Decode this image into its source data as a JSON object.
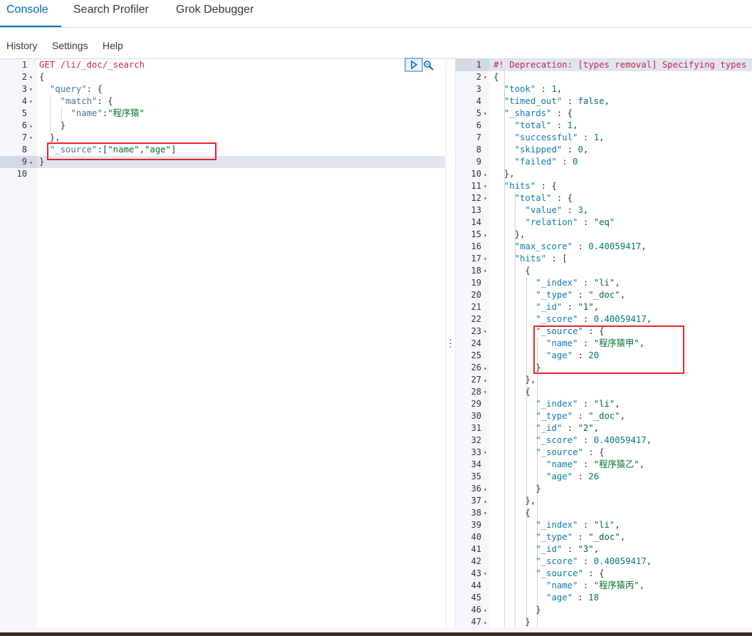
{
  "tabs": [
    "Console",
    "Search Profiler",
    "Grok Debugger"
  ],
  "menu": [
    "History",
    "Settings",
    "Help"
  ],
  "request": {
    "lines": [
      [
        {
          "t": "m",
          "v": "GET /li/_doc/_search"
        }
      ],
      [
        {
          "t": "p",
          "v": "{"
        }
      ],
      [
        {
          "t": "p",
          "v": "  "
        },
        {
          "t": "k",
          "v": "\"query\""
        },
        {
          "t": "p",
          "v": ": {"
        }
      ],
      [
        {
          "t": "p",
          "v": "    "
        },
        {
          "t": "k",
          "v": "\"match\""
        },
        {
          "t": "p",
          "v": ": {"
        }
      ],
      [
        {
          "t": "p",
          "v": "      "
        },
        {
          "t": "k",
          "v": "\"name\""
        },
        {
          "t": "p",
          "v": ":"
        },
        {
          "t": "s",
          "v": "\"程序猿\""
        }
      ],
      [
        {
          "t": "p",
          "v": "    }"
        }
      ],
      [
        {
          "t": "p",
          "v": "  },"
        }
      ],
      [
        {
          "t": "p",
          "v": "  "
        },
        {
          "t": "k",
          "v": "\"_source\""
        },
        {
          "t": "p",
          "v": ":["
        },
        {
          "t": "s",
          "v": "\"name\""
        },
        {
          "t": "p",
          "v": ","
        },
        {
          "t": "s",
          "v": "\"age\""
        },
        {
          "t": "p",
          "v": "]"
        }
      ],
      [
        {
          "t": "p",
          "v": "}"
        }
      ],
      []
    ],
    "folds": {
      "2": "▾",
      "3": "▾",
      "4": "▾",
      "6": "▴",
      "7": "▾",
      "9": "▴"
    }
  },
  "response": {
    "lines": [
      [
        {
          "t": "cmt",
          "v": "#! Deprecation: [types removal] Specifying types"
        }
      ],
      [
        {
          "t": "p",
          "v": "{"
        }
      ],
      [
        {
          "t": "p",
          "v": "  "
        },
        {
          "t": "kr",
          "v": "\"took\""
        },
        {
          "t": "p",
          "v": " : "
        },
        {
          "t": "n",
          "v": "1"
        },
        {
          "t": "p",
          "v": ","
        }
      ],
      [
        {
          "t": "p",
          "v": "  "
        },
        {
          "t": "kr",
          "v": "\"timed_out\""
        },
        {
          "t": "p",
          "v": " : "
        },
        {
          "t": "kw",
          "v": "false"
        },
        {
          "t": "p",
          "v": ","
        }
      ],
      [
        {
          "t": "p",
          "v": "  "
        },
        {
          "t": "kr",
          "v": "\"_shards\""
        },
        {
          "t": "p",
          "v": " : {"
        }
      ],
      [
        {
          "t": "p",
          "v": "    "
        },
        {
          "t": "kr",
          "v": "\"total\""
        },
        {
          "t": "p",
          "v": " : "
        },
        {
          "t": "n",
          "v": "1"
        },
        {
          "t": "p",
          "v": ","
        }
      ],
      [
        {
          "t": "p",
          "v": "    "
        },
        {
          "t": "kr",
          "v": "\"successful\""
        },
        {
          "t": "p",
          "v": " : "
        },
        {
          "t": "n",
          "v": "1"
        },
        {
          "t": "p",
          "v": ","
        }
      ],
      [
        {
          "t": "p",
          "v": "    "
        },
        {
          "t": "kr",
          "v": "\"skipped\""
        },
        {
          "t": "p",
          "v": " : "
        },
        {
          "t": "n",
          "v": "0"
        },
        {
          "t": "p",
          "v": ","
        }
      ],
      [
        {
          "t": "p",
          "v": "    "
        },
        {
          "t": "kr",
          "v": "\"failed\""
        },
        {
          "t": "p",
          "v": " : "
        },
        {
          "t": "n",
          "v": "0"
        }
      ],
      [
        {
          "t": "p",
          "v": "  },"
        }
      ],
      [
        {
          "t": "p",
          "v": "  "
        },
        {
          "t": "kr",
          "v": "\"hits\""
        },
        {
          "t": "p",
          "v": " : {"
        }
      ],
      [
        {
          "t": "p",
          "v": "    "
        },
        {
          "t": "kr",
          "v": "\"total\""
        },
        {
          "t": "p",
          "v": " : {"
        }
      ],
      [
        {
          "t": "p",
          "v": "      "
        },
        {
          "t": "kr",
          "v": "\"value\""
        },
        {
          "t": "p",
          "v": " : "
        },
        {
          "t": "n",
          "v": "3"
        },
        {
          "t": "p",
          "v": ","
        }
      ],
      [
        {
          "t": "p",
          "v": "      "
        },
        {
          "t": "kr",
          "v": "\"relation\""
        },
        {
          "t": "p",
          "v": " : "
        },
        {
          "t": "s",
          "v": "\"eq\""
        }
      ],
      [
        {
          "t": "p",
          "v": "    },"
        }
      ],
      [
        {
          "t": "p",
          "v": "    "
        },
        {
          "t": "kr",
          "v": "\"max_score\""
        },
        {
          "t": "p",
          "v": " : "
        },
        {
          "t": "n",
          "v": "0.40059417"
        },
        {
          "t": "p",
          "v": ","
        }
      ],
      [
        {
          "t": "p",
          "v": "    "
        },
        {
          "t": "kr",
          "v": "\"hits\""
        },
        {
          "t": "p",
          "v": " : ["
        }
      ],
      [
        {
          "t": "p",
          "v": "      {"
        }
      ],
      [
        {
          "t": "p",
          "v": "        "
        },
        {
          "t": "kr",
          "v": "\"_index\""
        },
        {
          "t": "p",
          "v": " : "
        },
        {
          "t": "s",
          "v": "\"li\""
        },
        {
          "t": "p",
          "v": ","
        }
      ],
      [
        {
          "t": "p",
          "v": "        "
        },
        {
          "t": "kr",
          "v": "\"_type\""
        },
        {
          "t": "p",
          "v": " : "
        },
        {
          "t": "s",
          "v": "\"_doc\""
        },
        {
          "t": "p",
          "v": ","
        }
      ],
      [
        {
          "t": "p",
          "v": "        "
        },
        {
          "t": "kr",
          "v": "\"_id\""
        },
        {
          "t": "p",
          "v": " : "
        },
        {
          "t": "s",
          "v": "\"1\""
        },
        {
          "t": "p",
          "v": ","
        }
      ],
      [
        {
          "t": "p",
          "v": "        "
        },
        {
          "t": "kr",
          "v": "\"_score\""
        },
        {
          "t": "p",
          "v": " : "
        },
        {
          "t": "n",
          "v": "0.40059417"
        },
        {
          "t": "p",
          "v": ","
        }
      ],
      [
        {
          "t": "p",
          "v": "        "
        },
        {
          "t": "kr",
          "v": "\"_source\""
        },
        {
          "t": "p",
          "v": " : {"
        }
      ],
      [
        {
          "t": "p",
          "v": "          "
        },
        {
          "t": "kr",
          "v": "\"name\""
        },
        {
          "t": "p",
          "v": " : "
        },
        {
          "t": "s",
          "v": "\"程序猿甲\""
        },
        {
          "t": "p",
          "v": ","
        }
      ],
      [
        {
          "t": "p",
          "v": "          "
        },
        {
          "t": "kr",
          "v": "\"age\""
        },
        {
          "t": "p",
          "v": " : "
        },
        {
          "t": "n",
          "v": "20"
        }
      ],
      [
        {
          "t": "p",
          "v": "        }"
        }
      ],
      [
        {
          "t": "p",
          "v": "      },"
        }
      ],
      [
        {
          "t": "p",
          "v": "      {"
        }
      ],
      [
        {
          "t": "p",
          "v": "        "
        },
        {
          "t": "kr",
          "v": "\"_index\""
        },
        {
          "t": "p",
          "v": " : "
        },
        {
          "t": "s",
          "v": "\"li\""
        },
        {
          "t": "p",
          "v": ","
        }
      ],
      [
        {
          "t": "p",
          "v": "        "
        },
        {
          "t": "kr",
          "v": "\"_type\""
        },
        {
          "t": "p",
          "v": " : "
        },
        {
          "t": "s",
          "v": "\"_doc\""
        },
        {
          "t": "p",
          "v": ","
        }
      ],
      [
        {
          "t": "p",
          "v": "        "
        },
        {
          "t": "kr",
          "v": "\"_id\""
        },
        {
          "t": "p",
          "v": " : "
        },
        {
          "t": "s",
          "v": "\"2\""
        },
        {
          "t": "p",
          "v": ","
        }
      ],
      [
        {
          "t": "p",
          "v": "        "
        },
        {
          "t": "kr",
          "v": "\"_score\""
        },
        {
          "t": "p",
          "v": " : "
        },
        {
          "t": "n",
          "v": "0.40059417"
        },
        {
          "t": "p",
          "v": ","
        }
      ],
      [
        {
          "t": "p",
          "v": "        "
        },
        {
          "t": "kr",
          "v": "\"_source\""
        },
        {
          "t": "p",
          "v": " : {"
        }
      ],
      [
        {
          "t": "p",
          "v": "          "
        },
        {
          "t": "kr",
          "v": "\"name\""
        },
        {
          "t": "p",
          "v": " : "
        },
        {
          "t": "s",
          "v": "\"程序猿乙\""
        },
        {
          "t": "p",
          "v": ","
        }
      ],
      [
        {
          "t": "p",
          "v": "          "
        },
        {
          "t": "kr",
          "v": "\"age\""
        },
        {
          "t": "p",
          "v": " : "
        },
        {
          "t": "n",
          "v": "26"
        }
      ],
      [
        {
          "t": "p",
          "v": "        }"
        }
      ],
      [
        {
          "t": "p",
          "v": "      },"
        }
      ],
      [
        {
          "t": "p",
          "v": "      {"
        }
      ],
      [
        {
          "t": "p",
          "v": "        "
        },
        {
          "t": "kr",
          "v": "\"_index\""
        },
        {
          "t": "p",
          "v": " : "
        },
        {
          "t": "s",
          "v": "\"li\""
        },
        {
          "t": "p",
          "v": ","
        }
      ],
      [
        {
          "t": "p",
          "v": "        "
        },
        {
          "t": "kr",
          "v": "\"_type\""
        },
        {
          "t": "p",
          "v": " : "
        },
        {
          "t": "s",
          "v": "\"_doc\""
        },
        {
          "t": "p",
          "v": ","
        }
      ],
      [
        {
          "t": "p",
          "v": "        "
        },
        {
          "t": "kr",
          "v": "\"_id\""
        },
        {
          "t": "p",
          "v": " : "
        },
        {
          "t": "s",
          "v": "\"3\""
        },
        {
          "t": "p",
          "v": ","
        }
      ],
      [
        {
          "t": "p",
          "v": "        "
        },
        {
          "t": "kr",
          "v": "\"_score\""
        },
        {
          "t": "p",
          "v": " : "
        },
        {
          "t": "n",
          "v": "0.40059417"
        },
        {
          "t": "p",
          "v": ","
        }
      ],
      [
        {
          "t": "p",
          "v": "        "
        },
        {
          "t": "kr",
          "v": "\"_source\""
        },
        {
          "t": "p",
          "v": " : {"
        }
      ],
      [
        {
          "t": "p",
          "v": "          "
        },
        {
          "t": "kr",
          "v": "\"name\""
        },
        {
          "t": "p",
          "v": " : "
        },
        {
          "t": "s",
          "v": "\"程序猿丙\""
        },
        {
          "t": "p",
          "v": ","
        }
      ],
      [
        {
          "t": "p",
          "v": "          "
        },
        {
          "t": "kr",
          "v": "\"age\""
        },
        {
          "t": "p",
          "v": " : "
        },
        {
          "t": "n",
          "v": "18"
        }
      ],
      [
        {
          "t": "p",
          "v": "        }"
        }
      ],
      [
        {
          "t": "p",
          "v": "      }"
        }
      ]
    ],
    "folds": {
      "2": "▾",
      "5": "▾",
      "10": "▴",
      "11": "▾",
      "12": "▾",
      "15": "▴",
      "17": "▾",
      "18": "▾",
      "23": "▾",
      "26": "▴",
      "27": "▴",
      "28": "▾",
      "33": "▾",
      "36": "▴",
      "37": "▴",
      "38": "▾",
      "43": "▾",
      "46": "▴",
      "47": "▴"
    }
  },
  "colors": {
    "accent": "#006bb4",
    "highlight": "#e5242b"
  },
  "icons": {
    "run": "play-icon",
    "settings": "wrench-icon",
    "drag": "vertical-dots-icon"
  }
}
